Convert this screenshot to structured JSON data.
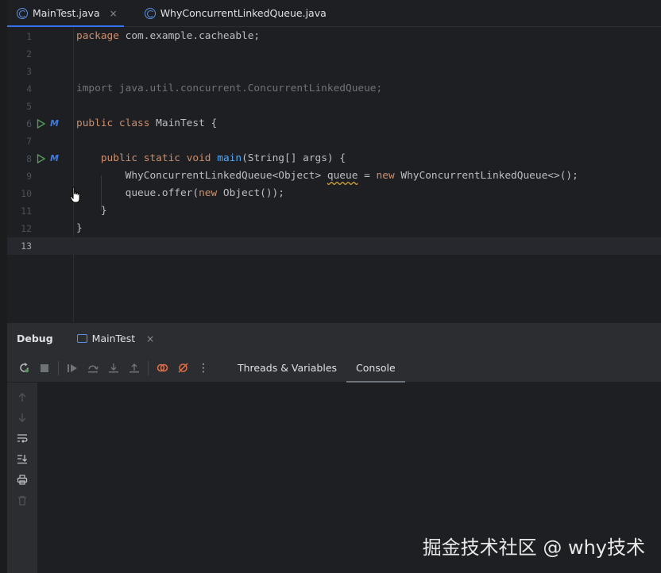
{
  "tabs": [
    {
      "label": "MainTest.java",
      "active": true,
      "close": "×"
    },
    {
      "label": "WhyConcurrentLinkedQueue.java",
      "active": false
    }
  ],
  "editor": {
    "line_numbers": [
      "1",
      "2",
      "3",
      "4",
      "5",
      "6",
      "7",
      "8",
      "9",
      "10",
      "11",
      "12",
      "13"
    ],
    "current_line": "13",
    "lines": {
      "l1_kw": "package",
      "l1_rest": " com.example.cacheable;",
      "l4": "import java.util.concurrent.ConcurrentLinkedQueue;",
      "l6_kw": "public class",
      "l6_rest": " MainTest {",
      "l8_indent": "    ",
      "l8_kw": "public static void",
      "l8_sp": " ",
      "l8_fn": "main",
      "l8_rest": "(String[] args) {",
      "l9_a": "        WhyConcurrentLinkedQueue<Object> ",
      "l9_var": "queue",
      "l9_b": " = ",
      "l9_kw": "new",
      "l9_c": " WhyConcurrentLinkedQueue<>();",
      "l10_a": "        queue.offer(",
      "l10_kw": "new",
      "l10_b": " Object());",
      "l11": "    }",
      "l12": "}"
    },
    "gutter_icon": "M"
  },
  "debug": {
    "title": "Debug",
    "session_tab": "MainTest",
    "session_close": "×",
    "toolbar_tabs": [
      "Threads & Variables",
      "Console"
    ],
    "active_tab": "Console",
    "more": "⋮"
  },
  "colors": {
    "keyword": "#cf8e6d",
    "function": "#56a8f5",
    "accent": "#3574f0"
  },
  "watermark": "掘金技术社区 @ why技术"
}
